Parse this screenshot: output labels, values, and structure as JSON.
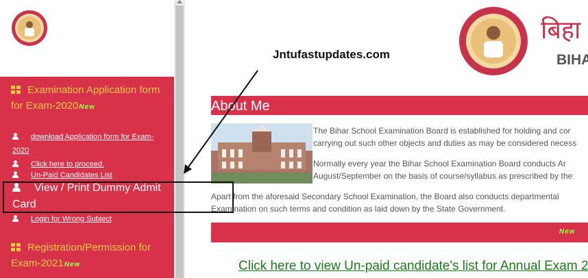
{
  "sidebar": {
    "section1": {
      "title": "Examination Application form for Exam-2020",
      "badge": "New"
    },
    "links1": [
      {
        "label": "download Application form for Exam-2020"
      },
      {
        "label": "Click here to proceed."
      },
      {
        "label": "Un-Paid Candidates List"
      }
    ],
    "highlight": {
      "label": "View / Print Dummy Admit Card"
    },
    "links2": [
      {
        "label": "Login for Wrong Subject"
      }
    ],
    "section2": {
      "title": "Registration/Permission for Exam-2021",
      "badge": "New"
    }
  },
  "watermark": "Jntufastupdates.com",
  "header": {
    "title_hindi": "बिहा",
    "title_en": "BIHA"
  },
  "about": {
    "title": "About Me",
    "para1_l1": "The Bihar School Examination Board is established for holding and cor",
    "para1_l2": "carrying out such other objects and duties as may be considered necess",
    "para2_l1": "Normally every year the Bihar School Examination Board conducts Ar",
    "para2_l2": "August/September on the basis of course/syllabus as prescribed by the",
    "para3_l1": "Apart from the aforesaid Secondary School Examination, the Board also conducts departmental",
    "para3_l2": "Examination on such terms and condition as laid down by the State Government.",
    "strip_badge": "New"
  },
  "unpaid_link": "Click here to view Un-paid candidate's list for Annual Exam 2",
  "colors": {
    "brand_red": "#d8314a",
    "heading_yellow": "#f6c945",
    "link_green": "#1c7b1c"
  },
  "icons": [
    "th-large-icon",
    "user-icon",
    "new-badge-icon",
    "seal-logo-icon"
  ]
}
